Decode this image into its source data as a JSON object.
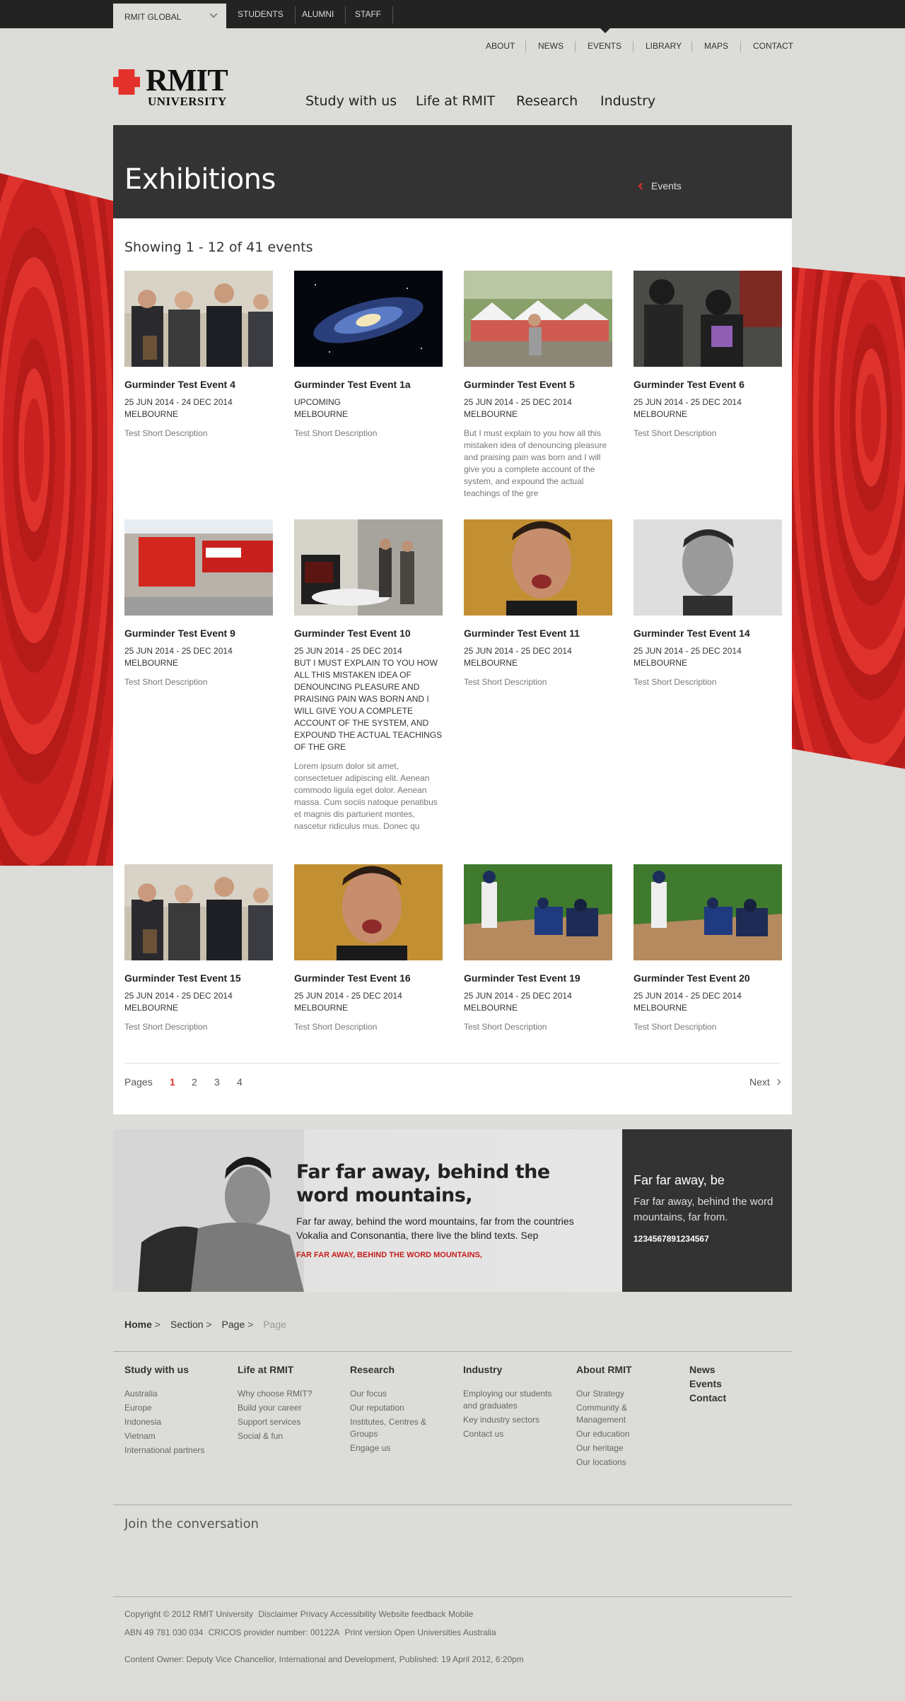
{
  "topbar": {
    "global": "RMIT GLOBAL",
    "links": [
      "STUDENTS",
      "ALUMNI",
      "STAFF"
    ]
  },
  "utility_nav": [
    "ABOUT",
    "NEWS",
    "EVENTS",
    "LIBRARY",
    "MAPS",
    "CONTACT"
  ],
  "logo": {
    "line1": "RMIT",
    "line2": "UNIVERSITY"
  },
  "main_nav": [
    "Study with us",
    "Life at RMIT",
    "Research",
    "Industry"
  ],
  "hero": {
    "title": "Exhibitions",
    "back_link": "Events"
  },
  "listing": {
    "showing": "Showing 1 - 12 of 41 events",
    "events": [
      {
        "title": "Gurminder Test Event 4",
        "meta": [
          "25 JUN 2014 - 24 DEC 2014",
          "MELBOURNE"
        ],
        "desc": "Test Short Description",
        "image": "group-photo"
      },
      {
        "title": "Gurminder Test Event 1a",
        "meta": [
          "UPCOMING",
          "MELBOURNE"
        ],
        "desc": "Test Short Description",
        "image": "galaxy"
      },
      {
        "title": "Gurminder Test Event 5",
        "meta": [
          "25 JUN 2014 - 25 DEC 2014",
          "MELBOURNE"
        ],
        "desc": "But I must explain to you how all this mistaken idea of denouncing pleasure and praising pain was born and I will give you a complete account of the system, and expound the actual teachings of the gre",
        "image": "market-tents"
      },
      {
        "title": "Gurminder Test Event 6",
        "meta": [
          "25 JUN 2014 - 25 DEC 2014",
          "MELBOURNE"
        ],
        "desc": "Test Short Description",
        "image": "exhibition-visitors"
      },
      {
        "title": "Gurminder Test Event 9",
        "meta": [
          "25 JUN 2014 - 25 DEC 2014",
          "MELBOURNE"
        ],
        "desc": "Test Short Description",
        "image": "building-banners"
      },
      {
        "title": "Gurminder Test Event 10",
        "meta": [
          "25 JUN 2014 - 25 DEC 2014",
          "BUT I MUST EXPLAIN TO YOU HOW ALL THIS MISTAKEN IDEA OF DENOUNCING PLEASURE AND PRAISING PAIN WAS BORN AND I WILL GIVE YOU A COMPLETE ACCOUNT OF THE SYSTEM, AND EXPOUND THE ACTUAL TEACHINGS OF THE GRE"
        ],
        "desc": "Lorem ipsum dolor sit amet, consectetuer adipiscing elit. Aenean commodo ligula eget dolor. Aenean massa. Cum sociis natoque penatibus et magnis dis parturient montes, nascetur ridiculus mus. Donec qu",
        "image": "book-display"
      },
      {
        "title": "Gurminder Test Event 11",
        "meta": [
          "25 JUN 2014 - 25 DEC 2014",
          "MELBOURNE"
        ],
        "desc": "Test Short Description",
        "image": "man-portrait"
      },
      {
        "title": "Gurminder Test Event 14",
        "meta": [
          "25 JUN 2014 - 25 DEC 2014",
          "MELBOURNE"
        ],
        "desc": "Test Short Description",
        "image": "bw-portrait"
      },
      {
        "title": "Gurminder Test Event 15",
        "meta": [
          "25 JUN 2014 - 25 DEC 2014",
          "MELBOURNE"
        ],
        "desc": "Test Short Description",
        "image": "group-photo"
      },
      {
        "title": "Gurminder Test Event 16",
        "meta": [
          "25 JUN 2014 - 25 DEC 2014",
          "MELBOURNE"
        ],
        "desc": "Test Short Description",
        "image": "man-portrait"
      },
      {
        "title": "Gurminder Test Event 19",
        "meta": [
          "25 JUN 2014 - 25 DEC 2014",
          "MELBOURNE"
        ],
        "desc": "Test Short Description",
        "image": "baseball"
      },
      {
        "title": "Gurminder Test Event 20",
        "meta": [
          "25 JUN 2014 - 25 DEC 2014",
          "MELBOURNE"
        ],
        "desc": "Test Short Description",
        "image": "baseball"
      }
    ]
  },
  "pagination": {
    "label": "Pages",
    "pages": [
      "1",
      "2",
      "3",
      "4"
    ],
    "current": "1",
    "next": "Next"
  },
  "promo": {
    "heading": "Far far away, behind the word mountains,",
    "body": "Far far away, behind the word mountains, far from the countries Vokalia and Consonantia, there live the blind texts. Sep",
    "cta": "FAR FAR AWAY, BEHIND THE WORD MOUNTAINS,"
  },
  "promo_side": {
    "heading": "Far far away, be",
    "body": "Far far away, behind the word mountains, far from.",
    "number": "1234567891234567"
  },
  "breadcrumb": [
    "Home",
    "Section",
    "Page",
    "Page"
  ],
  "footer": {
    "columns": [
      {
        "heading": "Study with us",
        "links": [
          "Australia",
          "Europe",
          "Indonesia",
          "Vietnam",
          "International partners"
        ]
      },
      {
        "heading": "Life at RMIT",
        "links": [
          "Why choose RMIT?",
          "Build your career",
          "Support services",
          "Social & fun"
        ]
      },
      {
        "heading": "Research",
        "links": [
          "Our focus",
          "Our reputation",
          "Institutes, Centres & Groups",
          "Engage us"
        ]
      },
      {
        "heading": "Industry",
        "links": [
          "Employing our students and graduates",
          "Key industry sectors",
          "Contact us"
        ]
      },
      {
        "heading": "About RMIT",
        "links": [
          "Our Strategy",
          "Community & Management",
          "Our education",
          "Our heritage",
          "Our locations"
        ]
      }
    ],
    "quick_links": [
      "News",
      "Events",
      "Contact"
    ],
    "join": "Join the conversation",
    "legal_line1": [
      "Copyright © 2012 RMIT University",
      "Disclaimer",
      "Privacy",
      "Accessibility",
      "Website feedback",
      "Mobile"
    ],
    "legal_line2": [
      "ABN 49 781 030 034",
      "CRICOS provider number: 00122A",
      "Print version",
      "Open Universities Australia"
    ],
    "content_owner": "Content Owner: Deputy Vice Chancellor, International and Development, Published: 19 April 2012, 6:20pm"
  },
  "colors": {
    "accent": "#e4312b",
    "dark": "#333333",
    "page_bg": "#dcdcd8"
  }
}
